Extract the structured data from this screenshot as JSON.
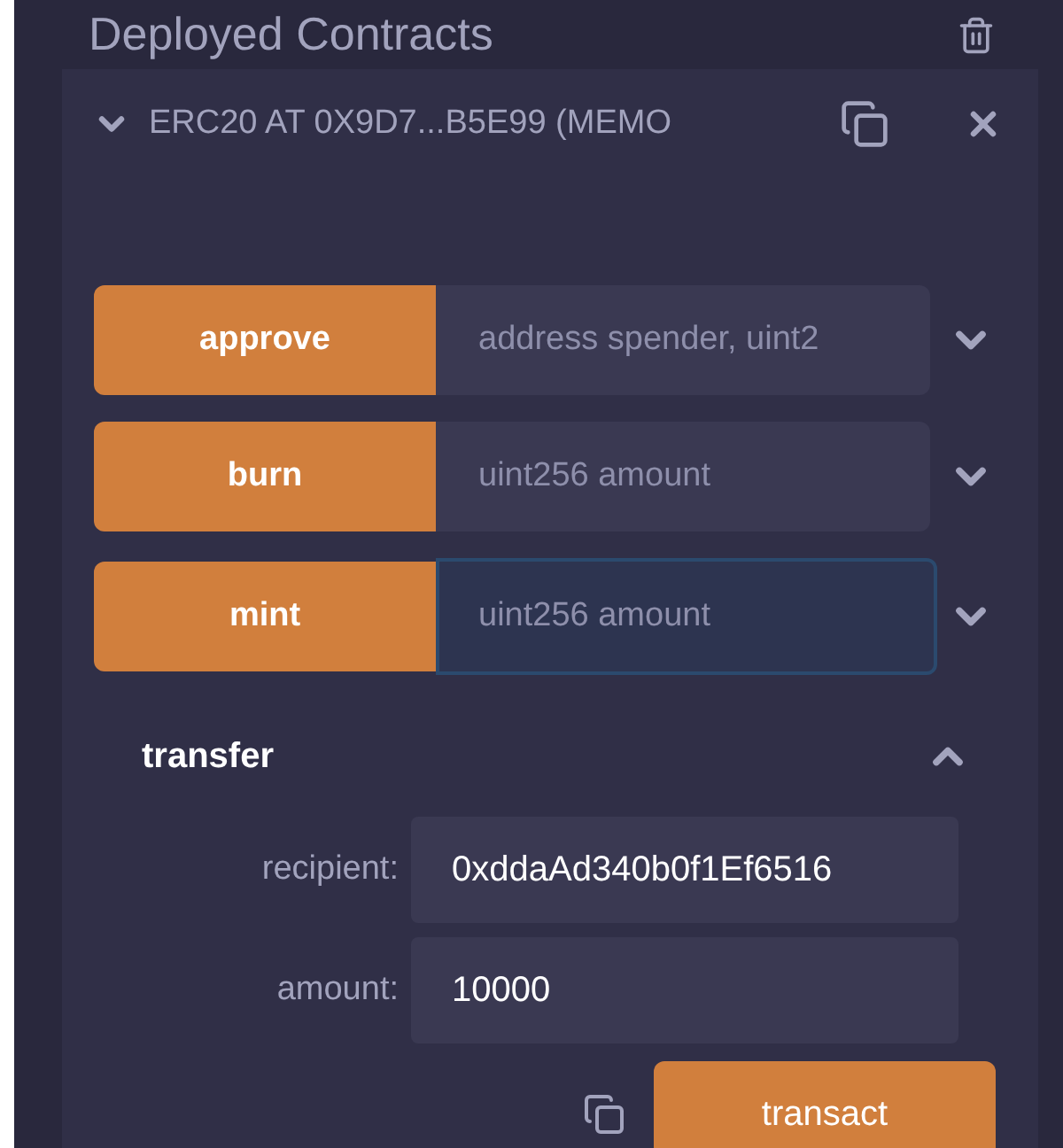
{
  "section": {
    "title": "Deployed Contracts"
  },
  "contract": {
    "title": "ERC20 AT 0X9D7...B5E99 (MEMO",
    "expanded": true
  },
  "functions": [
    {
      "name": "approve",
      "placeholder": "address spender, uint2",
      "focused": false
    },
    {
      "name": "burn",
      "placeholder": "uint256 amount",
      "focused": false
    },
    {
      "name": "mint",
      "placeholder": "uint256 amount",
      "focused": true
    }
  ],
  "transfer": {
    "name": "transfer",
    "expanded": true,
    "params": [
      {
        "label": "recipient:",
        "value": "0xddaAd340b0f1Ef6516"
      },
      {
        "label": "amount:",
        "value": "10000"
      }
    ],
    "button": "transact"
  }
}
